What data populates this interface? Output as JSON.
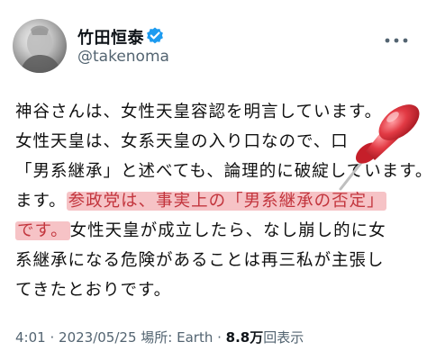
{
  "author": {
    "display_name": "竹田恒泰",
    "handle": "@takenoma"
  },
  "tweet": {
    "line1": "神谷さんは、女性天皇容認を明言しています。",
    "line2": "女性天皇は、女系天皇の入り口なので、口",
    "line3": "「男系継承」と述べても、論理的に破綻し",
    "line3_tail": "ています。",
    "line4_pre": "ます。",
    "line4_hl": "参政党は、事実上の「男系継承の否定」",
    "line5_hl": "です。",
    "line5_post": "女性天皇が成立したら、なし崩し的に女",
    "line6": "系継承になる危険があることは再三私が主張し",
    "line7": "てきたとおりです。"
  },
  "meta": {
    "time": "4:01",
    "separator": "·",
    "date": "2023/05/25",
    "place": "場所: Earth",
    "views_count": "8.8万",
    "views_label": "回表示"
  },
  "colors": {
    "highlight_bg": "#f6c3c6",
    "highlight_text": "#c3363e",
    "verified": "#1d9bf0"
  },
  "icons": [
    "verified-badge-icon",
    "more-icon",
    "pushpin-icon"
  ]
}
